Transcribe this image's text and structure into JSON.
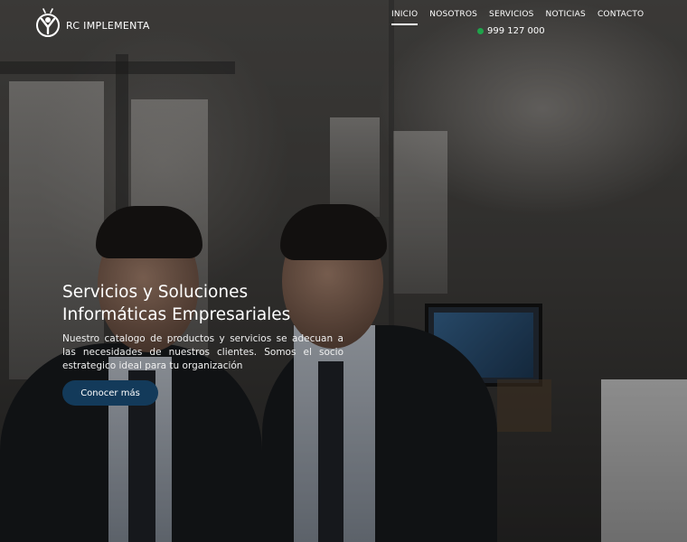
{
  "brand": {
    "name": "RC IMPLEMENTA"
  },
  "nav": {
    "items": [
      {
        "label": "INICIO",
        "active": true
      },
      {
        "label": "NOSOTROS",
        "active": false
      },
      {
        "label": "SERVICIOS",
        "active": false
      },
      {
        "label": "NOTICIAS",
        "active": false
      },
      {
        "label": "CONTACTO",
        "active": false
      }
    ],
    "phone": "999 127 000"
  },
  "hero": {
    "title_line1": "Servicios y Soluciones",
    "title_line2": "Informáticas Empresariales",
    "description": "Nuestro catalogo de productos y servicios se adecuan a las necesidades de nuestros clientes. Somos el socio estrategico ideal para tu organización",
    "cta_label": "Conocer más"
  },
  "colors": {
    "cta_bg": "#133a5a",
    "phone_icon": "#1fa34a",
    "text": "#ffffff"
  }
}
